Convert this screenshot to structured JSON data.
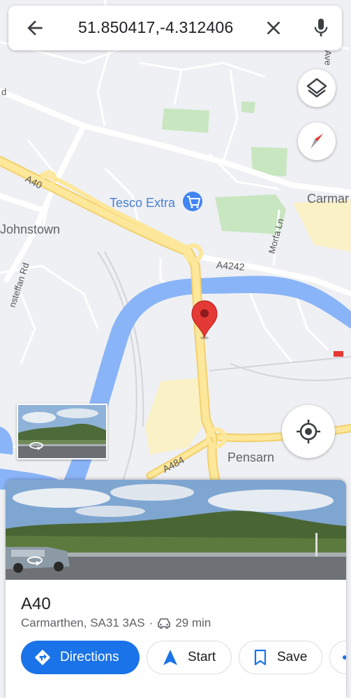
{
  "search": {
    "query": "51.850417,-4.312406"
  },
  "map_labels": {
    "tesco": "Tesco Extra",
    "johnstown": "Johnstown",
    "carmarthen_partial": "Carmar",
    "pensarn": "Pensarn",
    "a40": "A40",
    "a4242": "A4242",
    "a484": "A484",
    "morfa_ln": "Morfa Ln",
    "llansteffan_rd": "nsteffan Rd",
    "road_d": "d",
    "road_ave": "e Ave"
  },
  "place": {
    "title": "A40",
    "address": "Carmarthen, SA31 3AS",
    "separator": "·",
    "drive_time": "29 min"
  },
  "actions": {
    "directions": "Directions",
    "start": "Start",
    "save": "Save"
  },
  "colors": {
    "accent": "#1a73e8",
    "pin": "#e53935",
    "water": "#8ab4f8",
    "road": "#fce79a",
    "park": "#ccebc5"
  },
  "icons": [
    "back-arrow-icon",
    "close-icon",
    "microphone-icon",
    "layers-icon",
    "compass-icon",
    "my-location-icon",
    "map-pin-icon",
    "shopping-cart-icon",
    "street-view-360-icon",
    "car-icon",
    "directions-icon",
    "navigation-arrow-icon",
    "bookmark-icon"
  ]
}
